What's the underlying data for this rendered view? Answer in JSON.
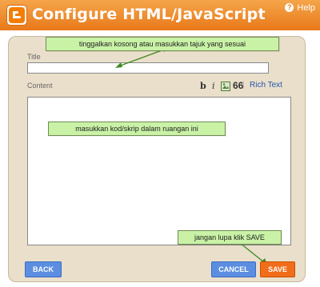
{
  "header": {
    "title": "Configure HTML/JavaScript",
    "help_label": "Help",
    "help_icon": "question-icon",
    "logo_icon": "blogger-logo-icon"
  },
  "form": {
    "title_label": "Title",
    "title_value": "",
    "content_label": "Content",
    "content_value": "",
    "toolbar": {
      "bold": "b",
      "italic": "i",
      "image_icon": "image-icon",
      "quote": "66",
      "rich_text": "Rich Text"
    }
  },
  "callouts": {
    "title_hint": "tinggalkan kosong atau masukkan tajuk yang sesuai",
    "content_hint": "masukkan kod/skrip dalam ruangan ini",
    "save_hint": "jangan lupa klik SAVE"
  },
  "buttons": {
    "back": "BACK",
    "cancel": "CANCEL",
    "save": "SAVE"
  },
  "colors": {
    "header": "#e8791a",
    "panel": "#eadfcb",
    "callout": "#c9f2a6",
    "blue_button": "#5b8ee0",
    "save_button": "#f26d1a"
  }
}
